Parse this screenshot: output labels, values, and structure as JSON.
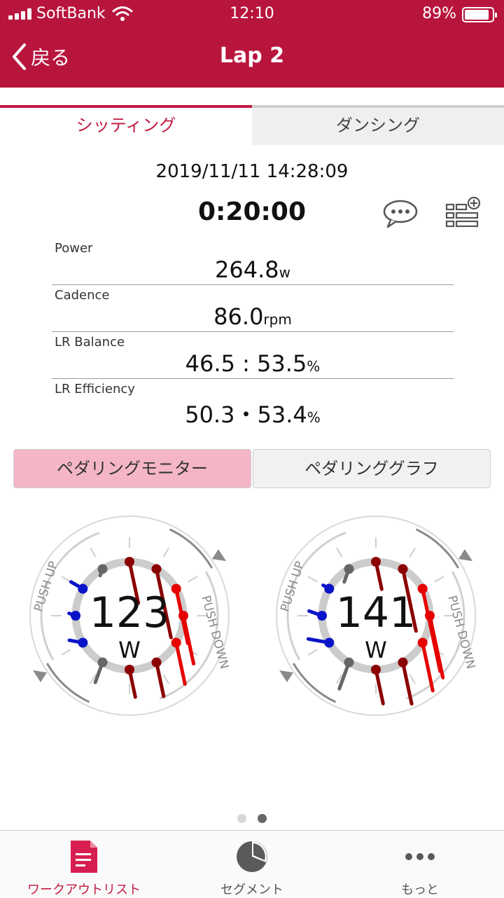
{
  "status_bar": {
    "carrier": "SoftBank",
    "time": "12:10",
    "battery": "89%",
    "battery_level": 0.89
  },
  "nav": {
    "back_label": "戻る",
    "title": "Lap 2"
  },
  "tabs": [
    {
      "label": "シッティング",
      "active": true
    },
    {
      "label": "ダンシング",
      "active": false
    }
  ],
  "summary": {
    "datetime": "2019/11/11 14:28:09",
    "duration": "0:20:00"
  },
  "metrics": [
    {
      "label": "Power",
      "value": "264.8",
      "unit": "w"
    },
    {
      "label": "Cadence",
      "value": "86.0",
      "unit": "rpm"
    },
    {
      "label": "LR Balance",
      "value": "46.5 : 53.5",
      "unit": "%"
    },
    {
      "label": "LR Efficiency",
      "value": "50.3・53.4",
      "unit": "%"
    }
  ],
  "view_toggle": {
    "monitor": "ペダリングモニター",
    "graph": "ペダリンググラフ",
    "selected": "monitor"
  },
  "gauges": [
    {
      "value": "123",
      "unit": "W",
      "push_up": "PUSH UP",
      "push_down": "PUSH DOWN",
      "vectors": [
        0.42,
        0.75,
        0.58,
        0.5,
        0.42,
        0.33,
        0.25,
        0.17,
        0.08,
        0.0,
        0.08,
        0.0
      ]
    },
    {
      "value": "141",
      "unit": "W",
      "push_up": "PUSH UP",
      "push_down": "PUSH DOWN",
      "vectors": [
        0.25,
        0.67,
        0.92,
        0.67,
        0.5,
        0.42,
        0.33,
        0.25,
        0.17,
        0.08,
        0.0,
        0.08
      ]
    }
  ],
  "pager": {
    "count": 2,
    "current": 2
  },
  "tabbar": [
    {
      "label": "ワークアウトリスト",
      "icon": "workout-list-icon",
      "active": true
    },
    {
      "label": "セグメント",
      "icon": "pie-chart-icon",
      "active": false
    },
    {
      "label": "もっと",
      "icon": "more-dots-icon",
      "active": false
    }
  ],
  "colors": {
    "brand": "#b8153d",
    "accent": "#c0193f",
    "push_down": "#e60000",
    "push_down_dark": "#8b0000",
    "push_up": "#0a14c8",
    "neutral": "#666666"
  }
}
